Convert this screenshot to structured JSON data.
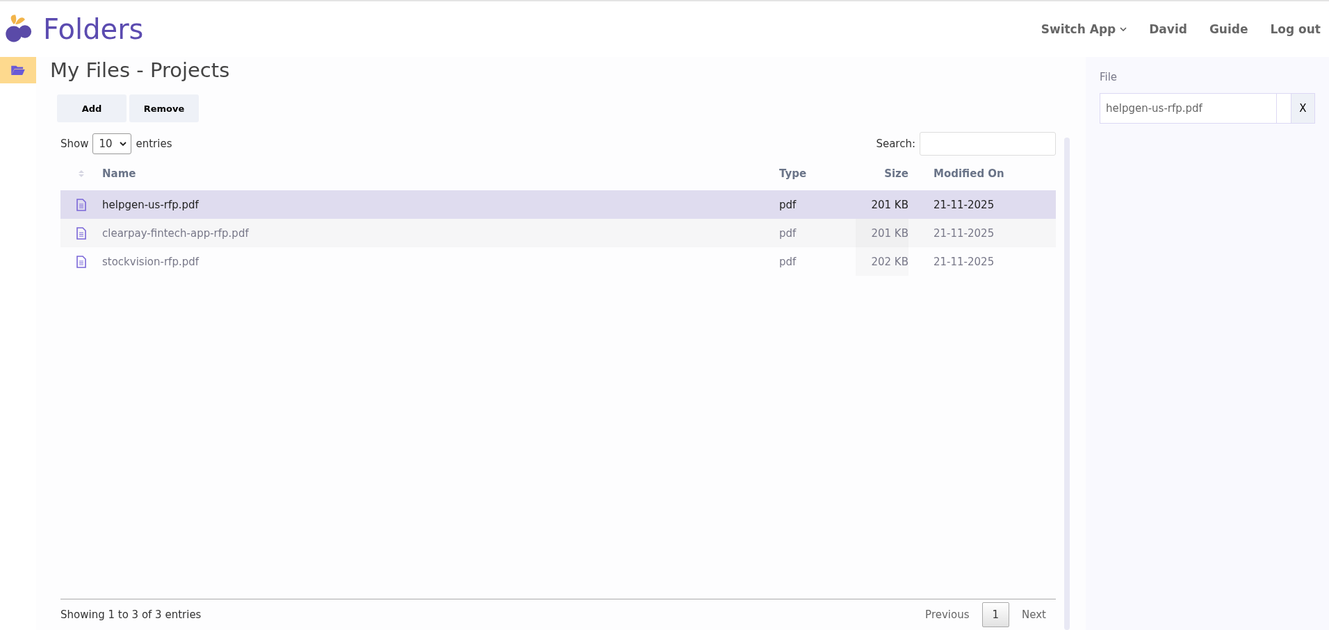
{
  "header": {
    "app_name": "Folders",
    "nav": [
      {
        "label": "Switch App",
        "dropdown": true
      },
      {
        "label": "David",
        "dropdown": false
      },
      {
        "label": "Guide",
        "dropdown": false
      },
      {
        "label": "Log out",
        "dropdown": false
      }
    ]
  },
  "page": {
    "title": "My Files - Projects",
    "actions": [
      "Add",
      "Remove"
    ]
  },
  "table": {
    "length_prefix": "Show",
    "length_value": "10",
    "length_suffix": "entries",
    "search_label": "Search:",
    "columns": [
      {
        "label": "Name"
      },
      {
        "label": "Type"
      },
      {
        "label": "Size"
      },
      {
        "label": "Modified On"
      }
    ],
    "rows": [
      {
        "name": "helpgen-us-rfp.pdf",
        "type": "pdf",
        "size": "201 KB",
        "modified": "21-11-2025",
        "selected": true
      },
      {
        "name": "clearpay-fintech-app-rfp.pdf",
        "type": "pdf",
        "size": "201 KB",
        "modified": "21-11-2025",
        "selected": false
      },
      {
        "name": "stockvision-rfp.pdf",
        "type": "pdf",
        "size": "202 KB",
        "modified": "21-11-2025",
        "selected": false
      }
    ],
    "info": "Showing 1 to 3 of 3 entries",
    "pagination": {
      "previous": "Previous",
      "pages": [
        {
          "label": "1",
          "selected": true
        }
      ],
      "next": "Next"
    }
  },
  "side_panel": {
    "label": "File",
    "value": "helpgen-us-rfp.pdf",
    "clear": "X"
  }
}
